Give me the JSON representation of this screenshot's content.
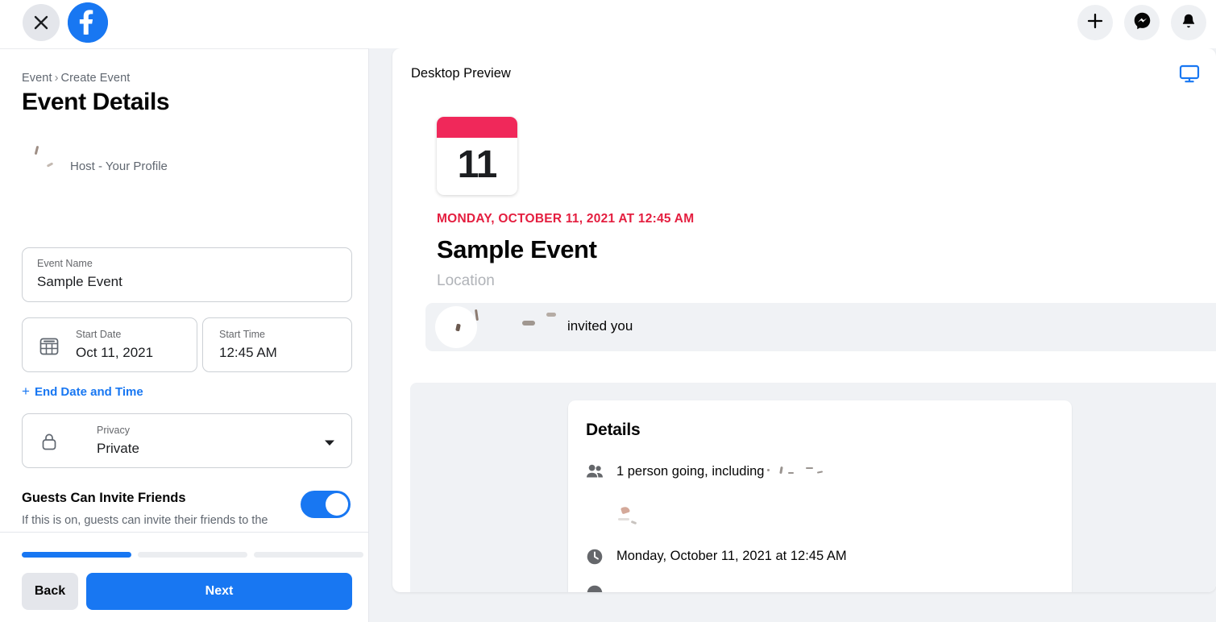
{
  "topbar": {
    "close_icon": "close-icon",
    "logo_icon": "facebook-logo-icon",
    "actions": [
      {
        "icon": "plus-icon",
        "name": "create-button"
      },
      {
        "icon": "messenger-icon",
        "name": "messenger-button"
      },
      {
        "icon": "bell-icon",
        "name": "notifications-button"
      }
    ]
  },
  "sidebar": {
    "breadcrumb": {
      "parent": "Event",
      "separator": "›",
      "current": "Create Event"
    },
    "title": "Event Details",
    "host": {
      "subtitle": "Host - Your Profile"
    },
    "fields": {
      "event_name": {
        "label": "Event Name",
        "value": "Sample Event",
        "placeholder": "Event Name"
      },
      "start_date": {
        "label": "Start Date",
        "value": "Oct 11, 2021",
        "icon": "calendar-icon"
      },
      "start_time": {
        "label": "Start Time",
        "value": "12:45 AM"
      },
      "privacy": {
        "label": "Privacy",
        "value": "Private",
        "icon": "lock-icon",
        "caret": "▾"
      }
    },
    "end_date_link": {
      "plus": "+",
      "label": "End Date and Time"
    },
    "guests": {
      "title": "Guests Can Invite Friends",
      "description": "If this is on, guests can invite their friends to the event.",
      "toggle_on": true
    },
    "footer": {
      "progress_steps": 3,
      "progress_active": 1,
      "back_label": "Back",
      "next_label": "Next"
    }
  },
  "preview": {
    "header_label": "Desktop Preview",
    "device_icon": "desktop-monitor-icon",
    "calendar": {
      "day": "11",
      "header_color": "#f0285a"
    },
    "event_date": "MONDAY, OCTOBER 11, 2021 AT 12:45 AM",
    "event_title": "Sample Event",
    "location_placeholder": "Location",
    "invite_banner": {
      "text": "invited you"
    },
    "details": {
      "title": "Details",
      "rows": [
        {
          "icon": "people-icon",
          "text": "1 person going, including"
        },
        {
          "icon": "clock-icon",
          "text": "Monday, October 11, 2021 at 12:45 AM"
        }
      ]
    }
  },
  "colors": {
    "brand_blue": "#1877f2",
    "accent_red": "#e41e3f",
    "calendar_red": "#f0285a",
    "surface_gray": "#f0f2f5",
    "text_primary": "#050505",
    "text_secondary": "#606770"
  }
}
